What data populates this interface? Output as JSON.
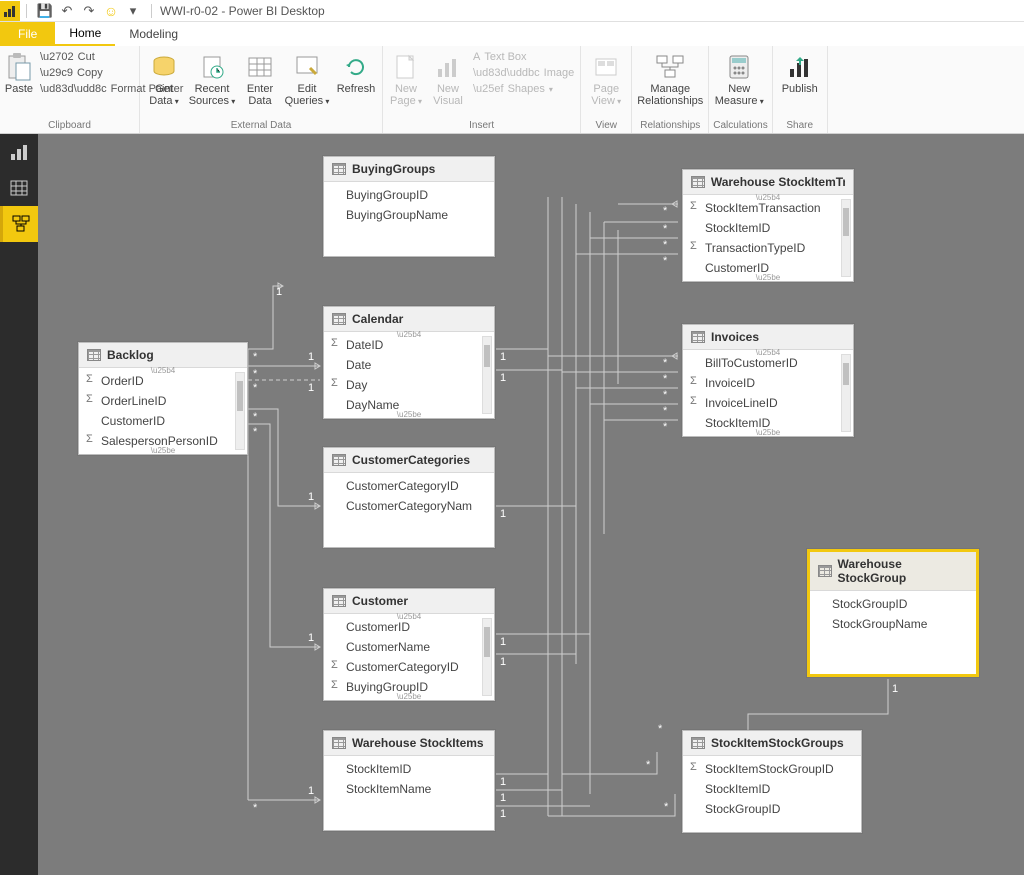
{
  "title": "WWI-r0-02 - Power BI Desktop",
  "qat": {
    "save": "💾",
    "undo": "↶",
    "redo": "↷",
    "smiley": "☺",
    "dropdown": "▾"
  },
  "tabs": {
    "file": "File",
    "home": "Home",
    "modeling": "Modeling"
  },
  "ribbon": {
    "clipboard": {
      "label": "Clipboard",
      "paste": "Paste",
      "cut": "Cut",
      "copy": "Copy",
      "format_painter": "Format Painter"
    },
    "external_data": {
      "label": "External Data",
      "get_data": "Get\nData",
      "recent_sources": "Recent\nSources",
      "enter_data": "Enter\nData",
      "edit_queries": "Edit\nQueries",
      "refresh": "Refresh"
    },
    "insert": {
      "label": "Insert",
      "new_page": "New\nPage",
      "new_visual": "New\nVisual",
      "text_box": "Text Box",
      "image": "Image",
      "shapes": "Shapes"
    },
    "view": {
      "label": "View",
      "page_view": "Page\nView"
    },
    "relationships": {
      "label": "Relationships",
      "manage": "Manage\nRelationships"
    },
    "calculations": {
      "label": "Calculations",
      "new_measure": "New\nMeasure"
    },
    "share": {
      "label": "Share",
      "publish": "Publish"
    }
  },
  "tables": {
    "backlog": {
      "name": "Backlog",
      "fields": [
        {
          "name": "OrderID",
          "sigma": true
        },
        {
          "name": "OrderLineID",
          "sigma": true
        },
        {
          "name": "CustomerID",
          "sigma": false
        },
        {
          "name": "SalespersonPersonID",
          "sigma": true
        }
      ]
    },
    "buying_groups": {
      "name": "BuyingGroups",
      "fields": [
        {
          "name": "BuyingGroupID",
          "sigma": false
        },
        {
          "name": "BuyingGroupName",
          "sigma": false
        }
      ]
    },
    "calendar": {
      "name": "Calendar",
      "fields": [
        {
          "name": "DateID",
          "sigma": true
        },
        {
          "name": "Date",
          "sigma": false
        },
        {
          "name": "Day",
          "sigma": true
        },
        {
          "name": "DayName",
          "sigma": false
        }
      ]
    },
    "customer_categories": {
      "name": "CustomerCategories",
      "fields": [
        {
          "name": "CustomerCategoryID",
          "sigma": false
        },
        {
          "name": "CustomerCategoryNam",
          "sigma": false
        }
      ]
    },
    "customer": {
      "name": "Customer",
      "fields": [
        {
          "name": "CustomerID",
          "sigma": false
        },
        {
          "name": "CustomerName",
          "sigma": false
        },
        {
          "name": "CustomerCategoryID",
          "sigma": true
        },
        {
          "name": "BuyingGroupID",
          "sigma": true
        }
      ]
    },
    "warehouse_stockitems": {
      "name": "Warehouse StockItems",
      "fields": [
        {
          "name": "StockItemID",
          "sigma": false
        },
        {
          "name": "StockItemName",
          "sigma": false
        }
      ]
    },
    "warehouse_stockitem_tr": {
      "name": "Warehouse StockItemTr",
      "fields": [
        {
          "name": "StockItemTransaction",
          "sigma": true
        },
        {
          "name": "StockItemID",
          "sigma": false
        },
        {
          "name": "TransactionTypeID",
          "sigma": true
        },
        {
          "name": "CustomerID",
          "sigma": false
        }
      ]
    },
    "invoices": {
      "name": "Invoices",
      "fields": [
        {
          "name": "BillToCustomerID",
          "sigma": false
        },
        {
          "name": "InvoiceID",
          "sigma": true
        },
        {
          "name": "InvoiceLineID",
          "sigma": true
        },
        {
          "name": "StockItemID",
          "sigma": false
        }
      ]
    },
    "warehouse_stockgroup": {
      "name": "Warehouse StockGroup",
      "fields": [
        {
          "name": "StockGroupID",
          "sigma": false
        },
        {
          "name": "StockGroupName",
          "sigma": false
        }
      ]
    },
    "stockitem_stockgroups": {
      "name": "StockItemStockGroups",
      "fields": [
        {
          "name": "StockItemStockGroupID",
          "sigma": true
        },
        {
          "name": "StockItemID",
          "sigma": false
        },
        {
          "name": "StockGroupID",
          "sigma": false
        }
      ]
    }
  },
  "relationship_labels": {
    "one": "1",
    "many": "*"
  }
}
